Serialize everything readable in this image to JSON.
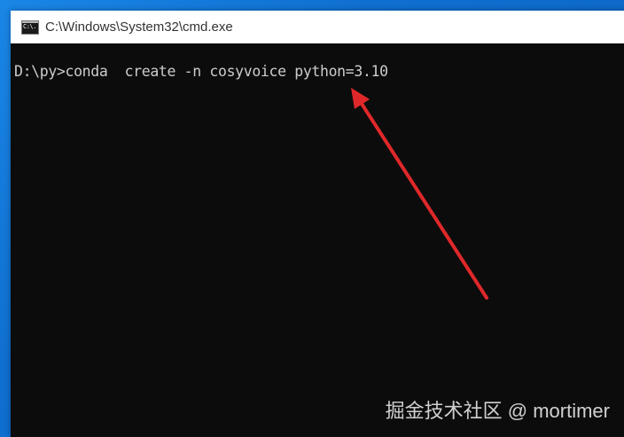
{
  "window": {
    "title": "C:\\Windows\\System32\\cmd.exe",
    "icon": "cmd-icon"
  },
  "console": {
    "line": "D:\\py>conda  create -n cosyvoice python=3.10"
  },
  "annotation": {
    "arrow_color": "#e0282a"
  },
  "watermark": "掘金技术社区 @ mortimer",
  "colors": {
    "desktop": "#0f6fd0",
    "console_bg": "#0c0c0c",
    "console_text": "#cccccc",
    "titlebar": "#ffffff"
  }
}
